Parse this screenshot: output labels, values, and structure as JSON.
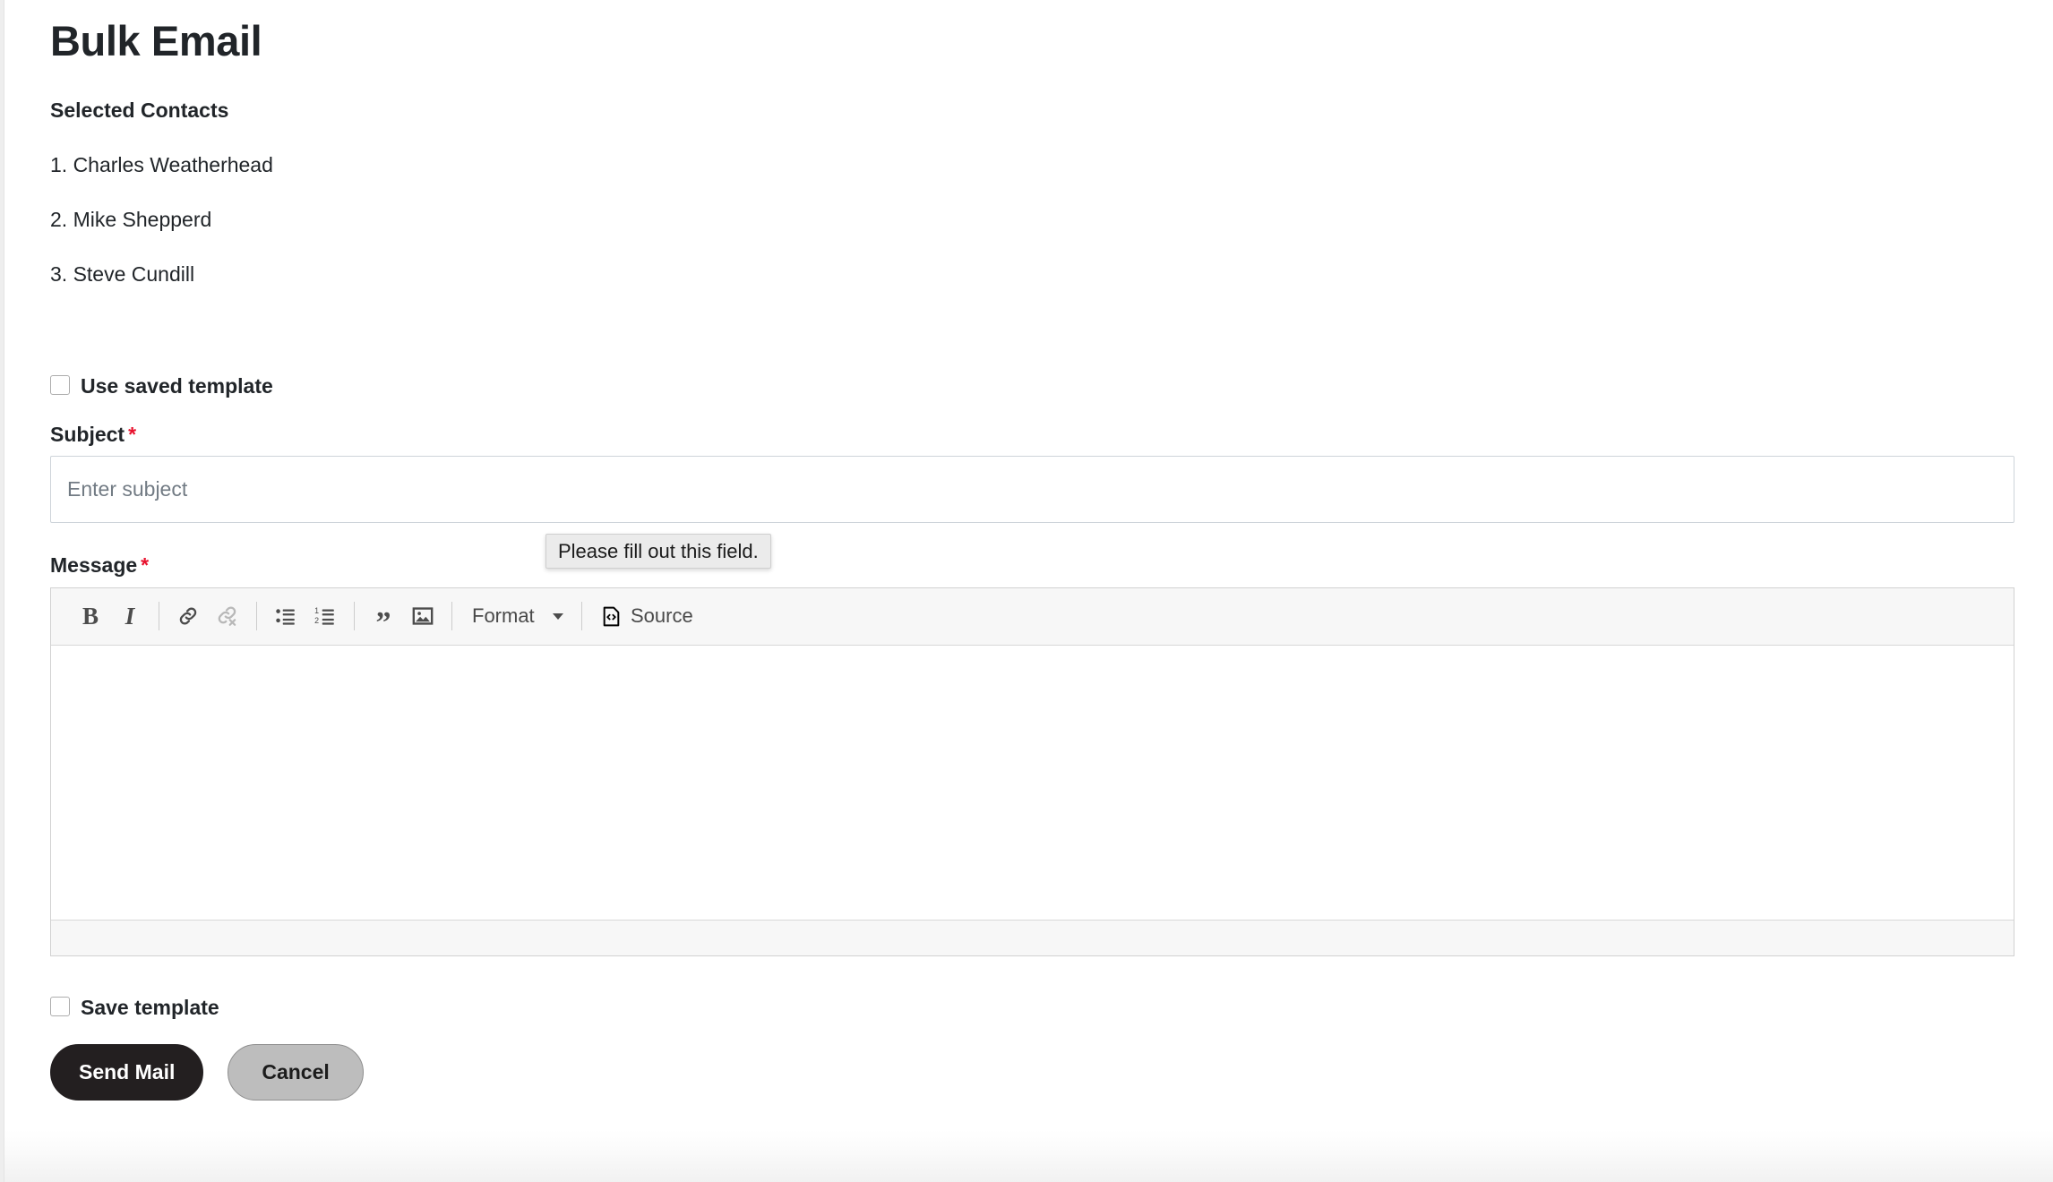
{
  "page": {
    "title": "Bulk Email"
  },
  "contacts": {
    "heading": "Selected Contacts",
    "items": [
      "1. Charles Weatherhead",
      "2. Mike Shepperd",
      "3. Steve Cundill"
    ]
  },
  "use_template": {
    "label": "Use saved template",
    "checked": false
  },
  "subject": {
    "label": "Subject",
    "required_marker": "*",
    "placeholder": "Enter subject",
    "value": ""
  },
  "validation": {
    "message": "Please fill out this field."
  },
  "message": {
    "label": "Message",
    "required_marker": "*",
    "content": ""
  },
  "toolbar": {
    "bold": "B",
    "italic": "I",
    "link_icon": "link-icon",
    "unlink_icon": "unlink-icon",
    "bulleted_list_icon": "bulleted-list-icon",
    "numbered_list_icon": "numbered-list-icon",
    "blockquote": "”",
    "image_icon": "image-icon",
    "format_label": "Format",
    "source_label": "Source"
  },
  "save_template": {
    "label": "Save template",
    "checked": false
  },
  "actions": {
    "send_label": "Send Mail",
    "cancel_label": "Cancel"
  },
  "colors": {
    "required_star": "#e8112d",
    "send_button_bg": "#231f20",
    "cancel_button_bg": "#bdbdbd",
    "toolbar_bg": "#f7f7f7",
    "tooltip_bg": "#ebebeb",
    "text": "#212529",
    "placeholder": "#727b84"
  }
}
